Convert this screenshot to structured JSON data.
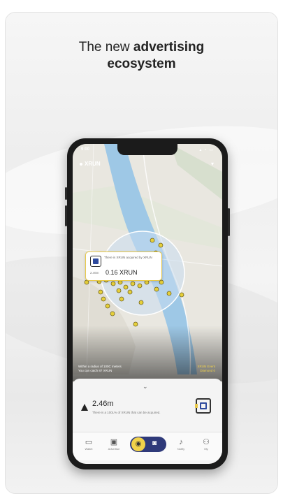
{
  "headline": {
    "line1_plain": "The new ",
    "line1_bold": "advertising",
    "line2": "ecosystem"
  },
  "status": {
    "time": "9:00",
    "icons": "▴ ◔ ▭"
  },
  "map": {
    "brand": "XRUN",
    "filter_icon": "filter-icon",
    "popup": {
      "desc": "There is XRUN acquired by XRUN",
      "small_label": "2.46m",
      "amount": "0.16 XRUN"
    },
    "radius_text_1": "Within a radius of 100C meters",
    "radius_text_2": "You can catch 87 XRUN",
    "xrun_event_1": "XRUN Event",
    "xrun_event_2": "Diamond 0"
  },
  "sheet": {
    "distance": "2.46m",
    "subtitle": "There is a 100L% of XRUN that can be acquired.",
    "chevron": "⌄"
  },
  "tabs": [
    {
      "icon": "▭",
      "label": "Wallet",
      "icon_name": "wallet-icon"
    },
    {
      "icon": "▣",
      "label": "Advertise",
      "icon_name": "ad-icon"
    },
    {
      "icon": "🔔",
      "label": "Notify",
      "icon_name": "bell-icon"
    },
    {
      "icon": "⚇",
      "label": "My",
      "icon_name": "person-icon"
    }
  ],
  "colors": {
    "accent_yellow": "#f1d24a",
    "nav_blue": "#2f3a7a",
    "river": "#9ec8e6"
  }
}
